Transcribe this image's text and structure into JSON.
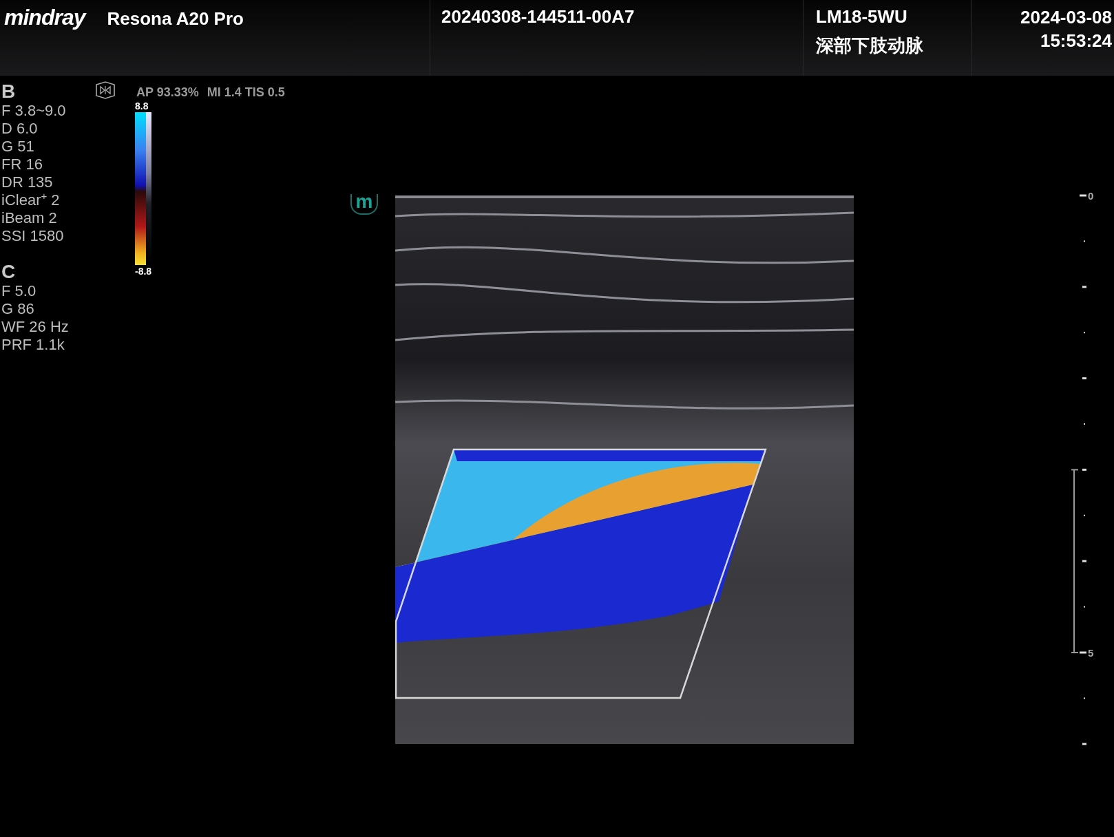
{
  "header": {
    "logo": "mindray",
    "model": "Resona A20 Pro",
    "exam_id": "20240308-144511-00A7",
    "probe": "LM18-5WU",
    "preset": "深部下肢动脉",
    "date": "2024-03-08",
    "time": "15:53:24"
  },
  "b_mode": {
    "title": "B",
    "params": [
      "F 3.8~9.0",
      "D 6.0",
      "G 51",
      "FR 16",
      "DR 135",
      "iClear$^{+}$ 2",
      "iBeam 2",
      "SSI 1580"
    ]
  },
  "c_mode": {
    "title": "C",
    "params": [
      "F 5.0",
      "G 86",
      "WF 26 Hz",
      "PRF 1.1k"
    ]
  },
  "acoustic_output": [
    "AP 93.33%",
    "MI 1.4 TIS 0.5"
  ],
  "color_scale": {
    "max": "8.8",
    "min": "-8.8"
  },
  "orientation_mark": "m",
  "depth_scale": {
    "labels": [
      "0",
      "5"
    ]
  }
}
